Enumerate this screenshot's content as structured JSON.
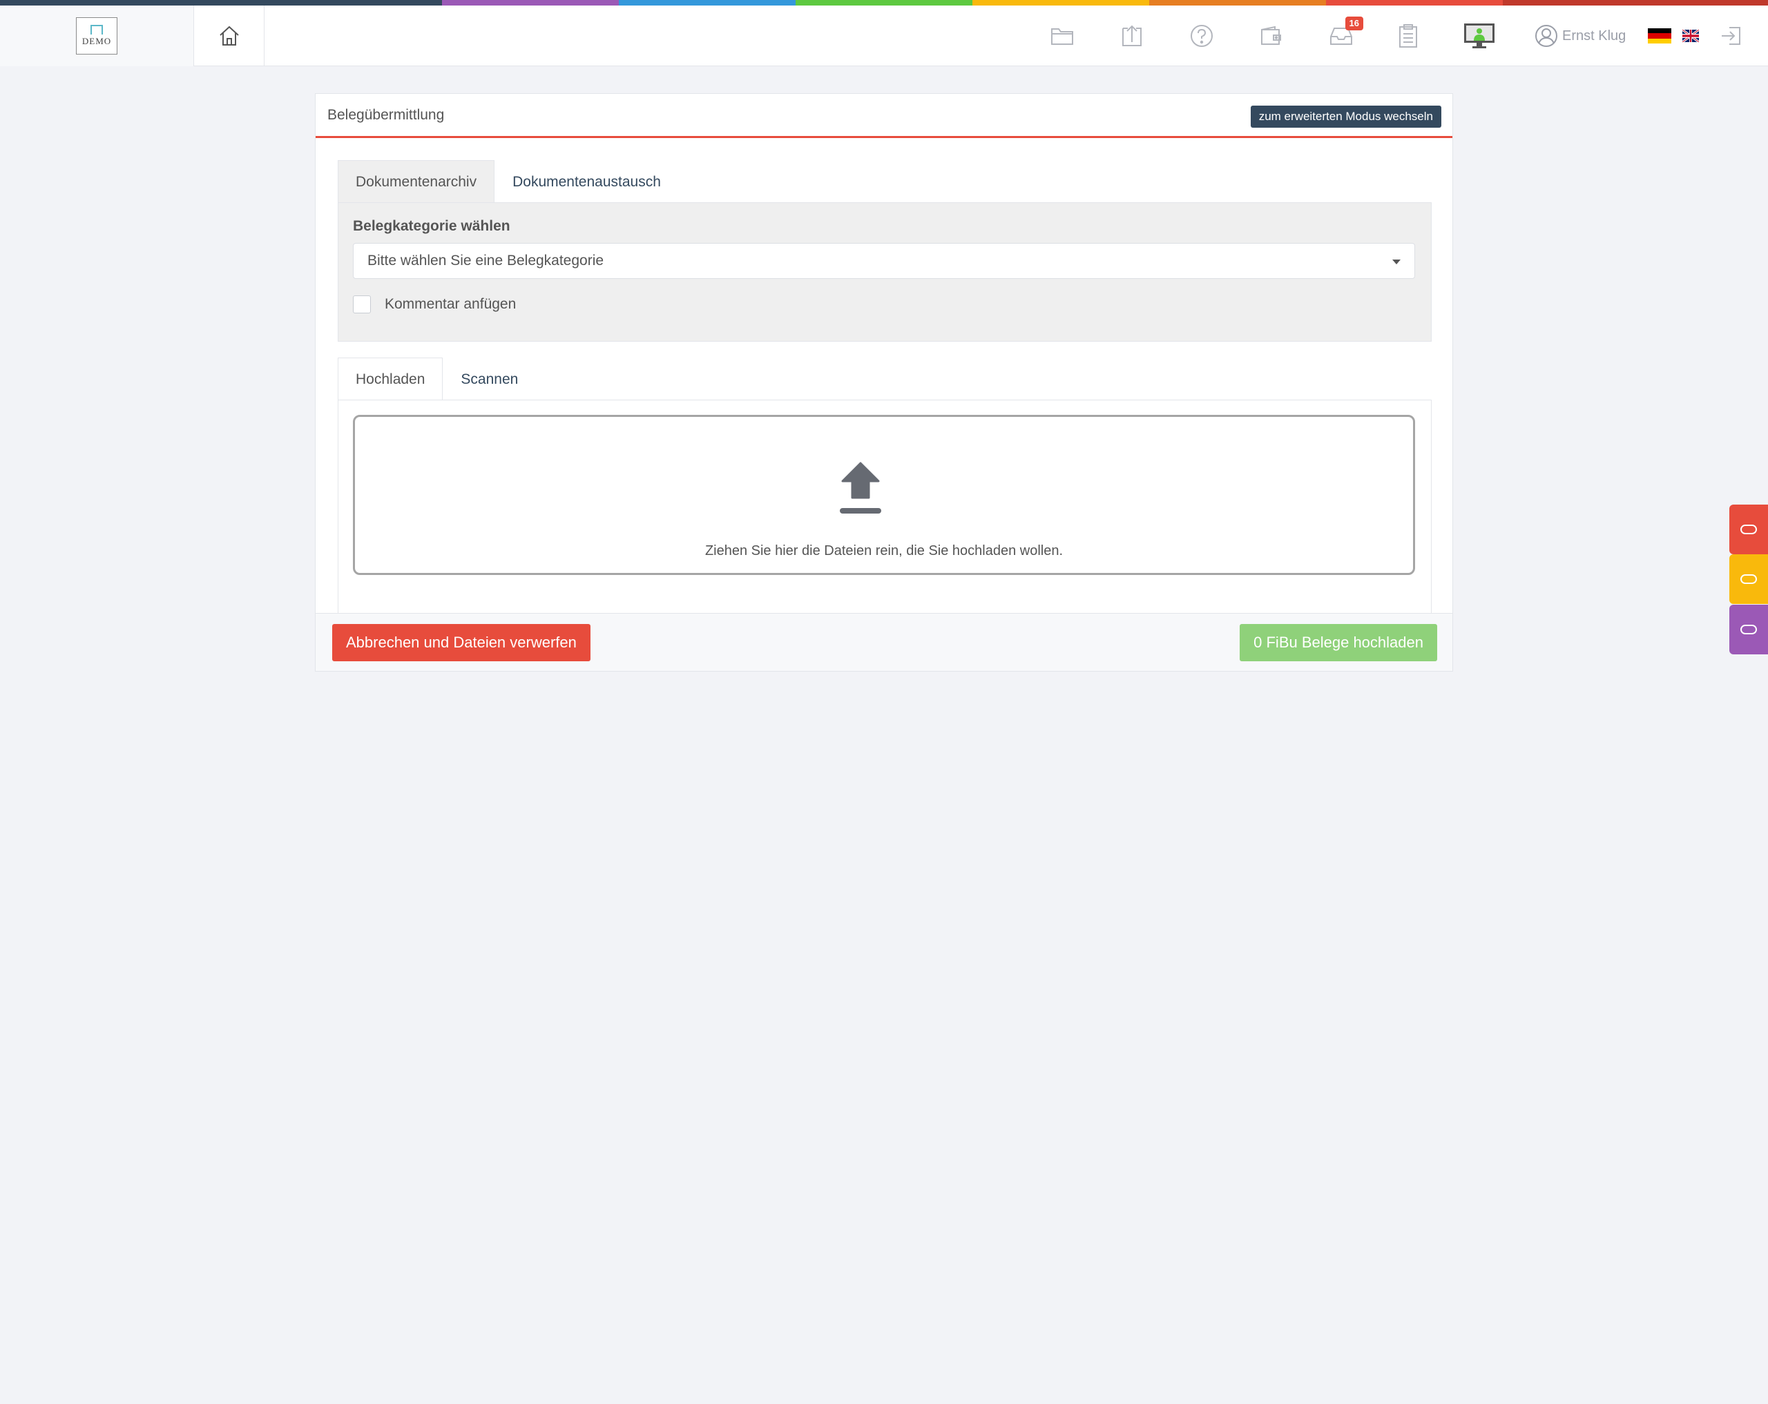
{
  "stripe_colors": [
    "#34495e",
    "#9b59b6",
    "#3498db",
    "#5ec940",
    "#f9b90c",
    "#e67e22",
    "#e74c3c",
    "#c0392b"
  ],
  "logo": {
    "text": "DEMO",
    "mark_color": "#5cb8c9"
  },
  "header": {
    "icons": [
      "home-icon",
      "folder-icon",
      "upload-icon",
      "help-icon",
      "wallet-icon",
      "inbox-icon",
      "clipboard-icon",
      "monitor-icon"
    ],
    "inbox_badge": "16",
    "user_name": "Ernst Klug",
    "languages": [
      "de",
      "en"
    ]
  },
  "card": {
    "title": "Belegübermittlung",
    "mode_button": "zum erweiterten Modus wechseln",
    "tabs": [
      {
        "label": "Dokumentenarchiv",
        "active": true
      },
      {
        "label": "Dokumentenaustausch",
        "active": false
      }
    ],
    "category": {
      "label": "Belegkategorie wählen",
      "placeholder": "Bitte wählen Sie eine Belegkategorie"
    },
    "comment_checkbox": {
      "label": "Kommentar anfügen",
      "checked": false
    },
    "upload_tabs": [
      {
        "label": "Hochladen",
        "active": true
      },
      {
        "label": "Scannen",
        "active": false
      }
    ],
    "dropzone_text": "Ziehen Sie hier die Dateien rein, die Sie hochladen wollen.",
    "cancel_button": "Abbrechen und Dateien verwerfen",
    "upload_button": "0 FiBu Belege hochladen"
  },
  "colors": {
    "accent_red": "#e74c3c",
    "dark_blue": "#34495e",
    "success_green": "#8fd17a",
    "side_red": "#e74c3c",
    "side_orange": "#f9b90c",
    "side_purple": "#9b59b6"
  }
}
